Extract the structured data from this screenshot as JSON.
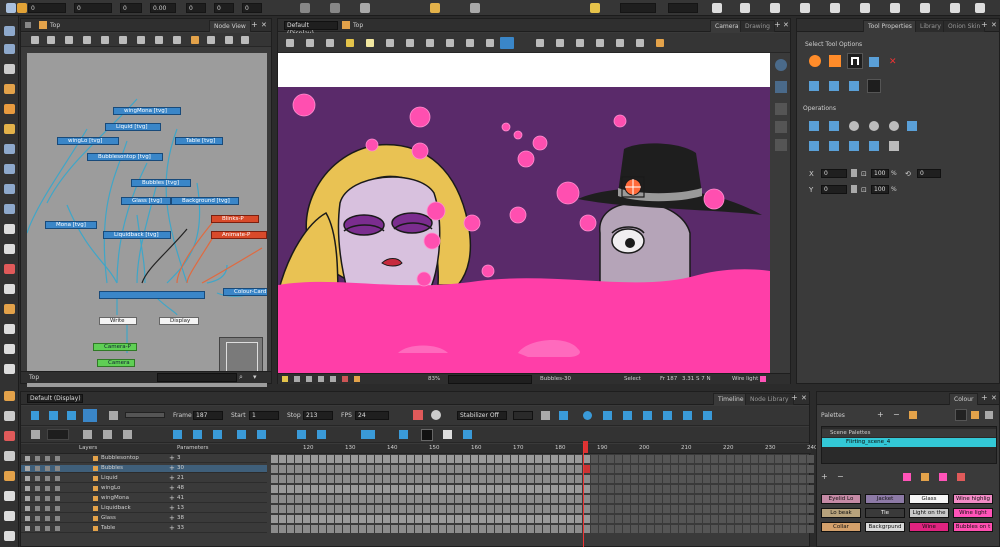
{
  "topbar": {
    "fields": [
      "0",
      "0",
      "0",
      "0.00",
      "0",
      "0",
      "0"
    ],
    "icon_names": [
      "select-icon",
      "pencil-icon",
      "camera-icon",
      "transform-icon"
    ]
  },
  "node_view": {
    "tab_label": "Top",
    "title": "Node View",
    "footer_label": "Top",
    "search_placeholder": "",
    "nodes": [
      {
        "label": "wingMona  [tvg]",
        "kind": "blue"
      },
      {
        "label": "Liquid  [tvg]",
        "kind": "blue"
      },
      {
        "label": "wingLo  [tvg]",
        "kind": "blue"
      },
      {
        "label": "Table  [tvg]",
        "kind": "blue"
      },
      {
        "label": "Bubblesontop  [tvg]",
        "kind": "blue"
      },
      {
        "label": "Bubbles  [tvg]",
        "kind": "blue"
      },
      {
        "label": "Glass  [tvg]",
        "kind": "blue"
      },
      {
        "label": "Background  [tvg]",
        "kind": "blue"
      },
      {
        "label": "Mona  [tvg]",
        "kind": "blue"
      },
      {
        "label": "Liquidback  [tvg]",
        "kind": "blue"
      },
      {
        "label": "Blinks-P",
        "kind": "red"
      },
      {
        "label": "Animate-P",
        "kind": "red"
      },
      {
        "label": "Colour-Card",
        "kind": "blue"
      },
      {
        "label": "Write",
        "kind": "white"
      },
      {
        "label": "Display",
        "kind": "white"
      },
      {
        "label": "Camera-P",
        "kind": "green"
      },
      {
        "label": "Camera",
        "kind": "green"
      }
    ]
  },
  "viewer": {
    "view_mode": "Default (Display)",
    "view_top": "Top",
    "tabs": [
      "Camera",
      "Drawing"
    ],
    "status": {
      "zoom": "83%",
      "frame_label": "Bubbles-30",
      "tool": "Select",
      "fr": "Fr 187",
      "coords": "3.31 S 7 N",
      "wire": "Wire light"
    },
    "colors": {
      "bg": "#5a2a6a",
      "liquid": "#ff3ea8",
      "hair": "#e9c253",
      "hat": "#1e1e1e"
    }
  },
  "tool_props": {
    "tabs": [
      "Tool Properties",
      "Library",
      "Onion Skin"
    ],
    "select_options_label": "Select Tool Options",
    "operations_label": "Operations",
    "fields": {
      "x": "0",
      "y": "0",
      "w": "100",
      "h": "100",
      "w_pct": "%",
      "h_pct": "%",
      "angle": "0"
    }
  },
  "timeline": {
    "tabs": [
      "Timeline",
      "Node Library"
    ],
    "view_mode": "Default (Display)",
    "frame_label": "Frame",
    "frame_value": "187",
    "start_label": "Start",
    "start_value": "1",
    "stop_label": "Stop",
    "stop_value": "213",
    "fps_label": "FPS",
    "fps_value": "24",
    "stabilizer": "Stabilizer Off",
    "layers_header": "Layers",
    "params_header": "Parameters",
    "ruler": [
      "120",
      "130",
      "140",
      "150",
      "160",
      "170",
      "180",
      "190",
      "200",
      "210",
      "220",
      "230",
      "240",
      "250"
    ],
    "layers": [
      {
        "name": "Bubblesontop",
        "param": "3"
      },
      {
        "name": "Bubbles",
        "param": "30"
      },
      {
        "name": "Liquid",
        "param": "21"
      },
      {
        "name": "wingLo",
        "param": "48"
      },
      {
        "name": "wingMona",
        "param": "41"
      },
      {
        "name": "Liquidback",
        "param": "13"
      },
      {
        "name": "Glass",
        "param": "38"
      },
      {
        "name": "Table",
        "param": "33"
      }
    ]
  },
  "colour": {
    "tab": "Colour",
    "palettes_label": "Palettes",
    "scene_palettes_label": "Scene Palettes",
    "palette_item": "Flirting_scene_4",
    "swatches": [
      {
        "label": "Eyelid Lo",
        "color": "#c58aa5"
      },
      {
        "label": "Jacket",
        "color": "#8d7aa6"
      },
      {
        "label": "Glass",
        "color": "#f6f6f6"
      },
      {
        "label": "Wine highlig",
        "color": "#f28bc6"
      },
      {
        "label": "Lo beak",
        "color": "#b7a27c"
      },
      {
        "label": "Tie",
        "color": "#3a3a3a"
      },
      {
        "label": "Light on the",
        "color": "#c9c9c9"
      },
      {
        "label": "Wine light",
        "color": "#ff53b8"
      },
      {
        "label": "Collar",
        "color": "#d3a06b"
      },
      {
        "label": "Backgrpund",
        "color": "#d9d9d9"
      },
      {
        "label": "Wine",
        "color": "#e0237f"
      },
      {
        "label": "Bubbles on t",
        "color": "#ff4fb0"
      }
    ]
  }
}
